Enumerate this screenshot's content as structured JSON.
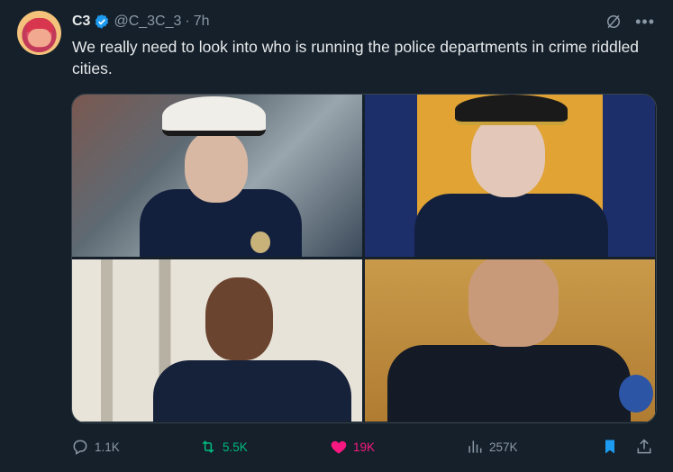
{
  "tweet": {
    "author_name": "C3",
    "handle": "@C_3C_3",
    "separator": "·",
    "time": "7h",
    "text": "We really need to look into who is running the police departments in crime riddled cities."
  },
  "actions": {
    "replies": "1.1K",
    "retweets": "5.5K",
    "likes": "19K",
    "views": "257K"
  },
  "colors": {
    "background": "#15202b",
    "retweet_active": "#00ba7c",
    "like_active": "#f91880",
    "verified": "#1d9bf0",
    "bookmark_active": "#1d9bf0"
  },
  "icons": [
    "verified-badge-icon",
    "grok-icon",
    "more-icon",
    "reply-icon",
    "retweet-icon",
    "heart-icon",
    "views-icon",
    "bookmark-icon",
    "share-icon"
  ]
}
